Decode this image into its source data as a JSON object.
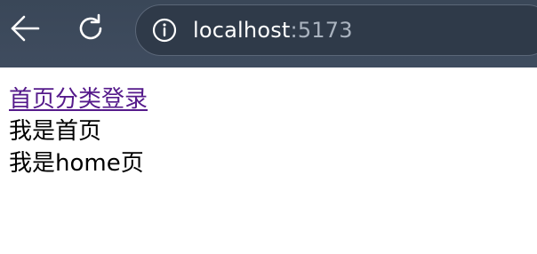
{
  "browser": {
    "url_host": "localhost",
    "url_port": ":5173",
    "icons": {
      "back": "arrow-left-icon",
      "reload": "reload-icon",
      "info": "info-circle-icon"
    }
  },
  "page": {
    "nav": [
      {
        "label": "首页"
      },
      {
        "label": "分类"
      },
      {
        "label": "登录"
      }
    ],
    "text_line_1": "我是首页",
    "text_line_2": "我是home页"
  },
  "colors": {
    "toolbar_bg": "#3f4c5f",
    "link_visited": "#551a8b",
    "text": "#000000"
  }
}
